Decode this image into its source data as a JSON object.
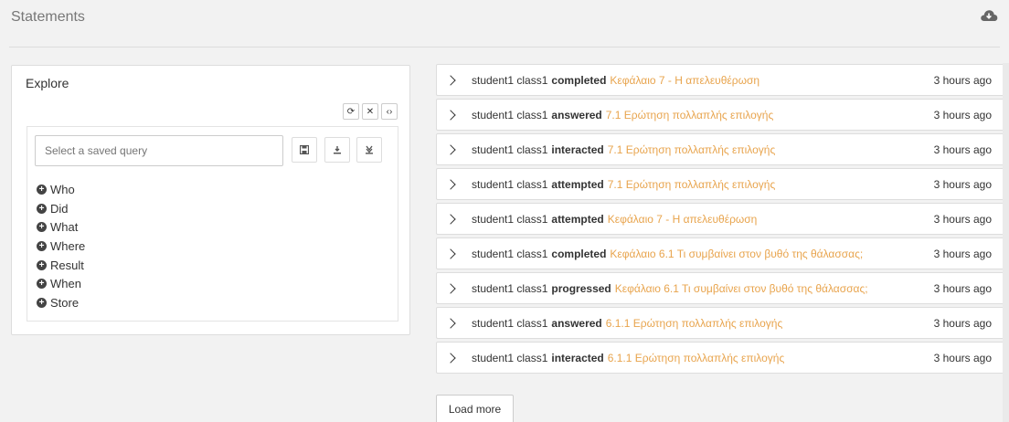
{
  "header": {
    "title": "Statements",
    "download_icon": "cloud-download-icon"
  },
  "explore": {
    "title": "Explore",
    "tools": [
      {
        "name": "refresh",
        "glyph": "⟳"
      },
      {
        "name": "clear",
        "glyph": "✕"
      },
      {
        "name": "code",
        "glyph": "‹›"
      }
    ],
    "query_placeholder": "Select a saved query",
    "query_buttons": [
      "save-icon",
      "download-icon",
      "export-icon"
    ],
    "filters": [
      "Who",
      "Did",
      "What",
      "Where",
      "Result",
      "When",
      "Store"
    ]
  },
  "statements": [
    {
      "actor": "student1 class1",
      "verb": "completed",
      "object": "Κεφάλαιο 7 - Η απελευθέρωση",
      "time": "3 hours ago"
    },
    {
      "actor": "student1 class1",
      "verb": "answered",
      "object": "7.1 Ερώτηση πολλαπλής επιλογής",
      "time": "3 hours ago"
    },
    {
      "actor": "student1 class1",
      "verb": "interacted",
      "object": "7.1 Ερώτηση πολλαπλής επιλογής",
      "time": "3 hours ago"
    },
    {
      "actor": "student1 class1",
      "verb": "attempted",
      "object": "7.1 Ερώτηση πολλαπλής επιλογής",
      "time": "3 hours ago"
    },
    {
      "actor": "student1 class1",
      "verb": "attempted",
      "object": "Κεφάλαιο 7 - Η απελευθέρωση",
      "time": "3 hours ago"
    },
    {
      "actor": "student1 class1",
      "verb": "completed",
      "object": "Κεφάλαιο 6.1 Τι συμβαίνει στον βυθό της θάλασσας;",
      "time": "3 hours ago"
    },
    {
      "actor": "student1 class1",
      "verb": "progressed",
      "object": "Κεφάλαιο 6.1 Τι συμβαίνει στον βυθό της θάλασσας;",
      "time": "3 hours ago"
    },
    {
      "actor": "student1 class1",
      "verb": "answered",
      "object": "6.1.1 Ερώτηση πολλαπλής επιλογής",
      "time": "3 hours ago"
    },
    {
      "actor": "student1 class1",
      "verb": "interacted",
      "object": "6.1.1 Ερώτηση πολλαπλής επιλογής",
      "time": "3 hours ago"
    }
  ],
  "load_more_label": "Load more",
  "colors": {
    "object_link": "#e8a44d",
    "panel_bg": "#ffffff",
    "page_bg": "#f2f2f2"
  }
}
